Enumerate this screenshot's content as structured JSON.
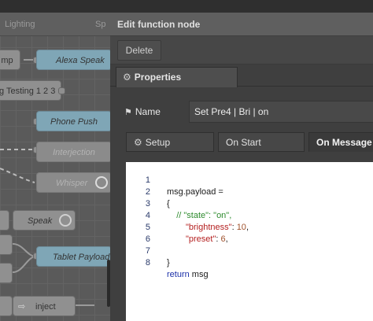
{
  "workspace": {
    "tabs": [
      "Lighting",
      "Sp"
    ],
    "nodes": {
      "amp_fragment": "mp",
      "alexa_speak": "Alexa Speak",
      "testing": "g Testing 1 2 3",
      "phone_push": "Phone Push",
      "interjection": "Interjection",
      "whisper": "Whisper",
      "speak": "Speak",
      "tablet_payload": "Tablet Payload",
      "inject": "inject"
    }
  },
  "tray": {
    "title": "Edit function node",
    "delete_label": "Delete",
    "properties_tab": "Properties",
    "name_label": "Name",
    "name_value": "Set Pre4 | Bri | on",
    "sub_tabs": {
      "setup": "Setup",
      "on_start": "On Start",
      "on_message": "On Message"
    },
    "code": {
      "line_numbers": [
        "1",
        "2",
        "3",
        "4",
        "5",
        "6",
        "7",
        "8"
      ],
      "line1": "msg.payload =",
      "line2": "{",
      "line3": "    // \"state\": \"on\",",
      "line4_key": "\"brightness\"",
      "line4_sep": ": ",
      "line4_val": "10",
      "line4_end": ",",
      "line5_key": "\"preset\"",
      "line5_sep": ": ",
      "line5_val": "6",
      "line5_end": ",",
      "line6": "",
      "line7": "}",
      "line8_kw": "return",
      "line8_rest": " msg"
    }
  },
  "colors": {
    "function_node": "#7fa6b6",
    "tray_bg": "#3f3f3f",
    "comment": "#2e8b2e",
    "string_key": "#b41f1f",
    "keyword": "#1b2fa8"
  }
}
